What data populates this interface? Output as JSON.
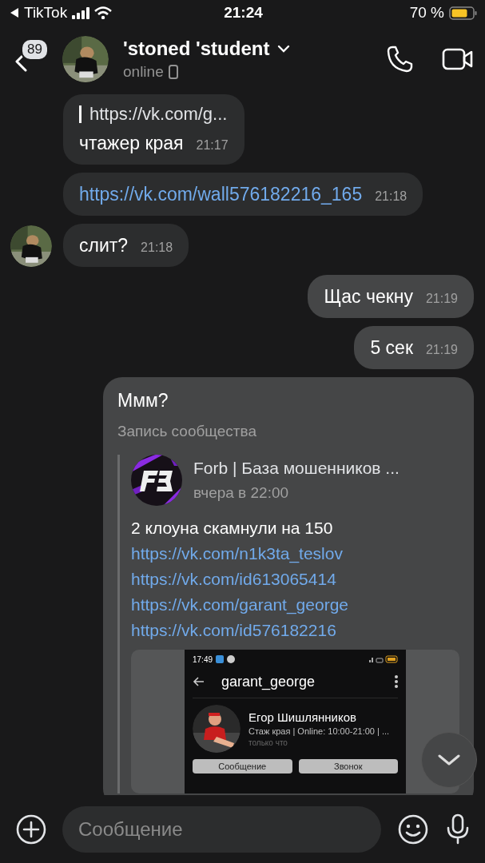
{
  "status_bar": {
    "back_app": "TikTok",
    "time": "21:24",
    "battery": "70 %"
  },
  "header": {
    "unread_count": "89",
    "name": "'stoned 'student",
    "status": "online"
  },
  "messages": [
    {
      "kind": "text",
      "outgoing": false,
      "show_avatar": false,
      "quote": "https://vk.com/g...",
      "text": "чтажер края",
      "time": "21:17"
    },
    {
      "kind": "link",
      "outgoing": false,
      "show_avatar": false,
      "text": "https://vk.com/wall576182216_165",
      "time": "21:18"
    },
    {
      "kind": "text",
      "outgoing": false,
      "show_avatar": true,
      "text": "слит?",
      "time": "21:18"
    },
    {
      "kind": "text",
      "outgoing": true,
      "show_avatar": false,
      "text": "Щас чекну",
      "time": "21:19"
    },
    {
      "kind": "text",
      "outgoing": true,
      "show_avatar": false,
      "text": "5 сек",
      "time": "21:19"
    },
    {
      "kind": "repost",
      "outgoing": true,
      "show_avatar": false,
      "text": "Ммм?",
      "label": "Запись сообщества",
      "post": {
        "author": "Forb | База мошенников ...",
        "date": "вчера в 22:00",
        "text": "2 клоуна скамнули на 150",
        "links": [
          "https://vk.com/n1k3ta_teslov",
          "https://vk.com/id613065414",
          "https://vk.com/garant_george",
          "https://vk.com/id576182216"
        ],
        "screenshot": {
          "time": "17:49",
          "title": "garant_george",
          "name": "Егор Шишлянников",
          "bio": "Стаж края | Online: 10:00-21:00 | ...",
          "seen": "только что",
          "buttons": [
            "Сообщение",
            "Звонок"
          ]
        }
      }
    }
  ],
  "composer": {
    "placeholder": "Сообщение"
  }
}
